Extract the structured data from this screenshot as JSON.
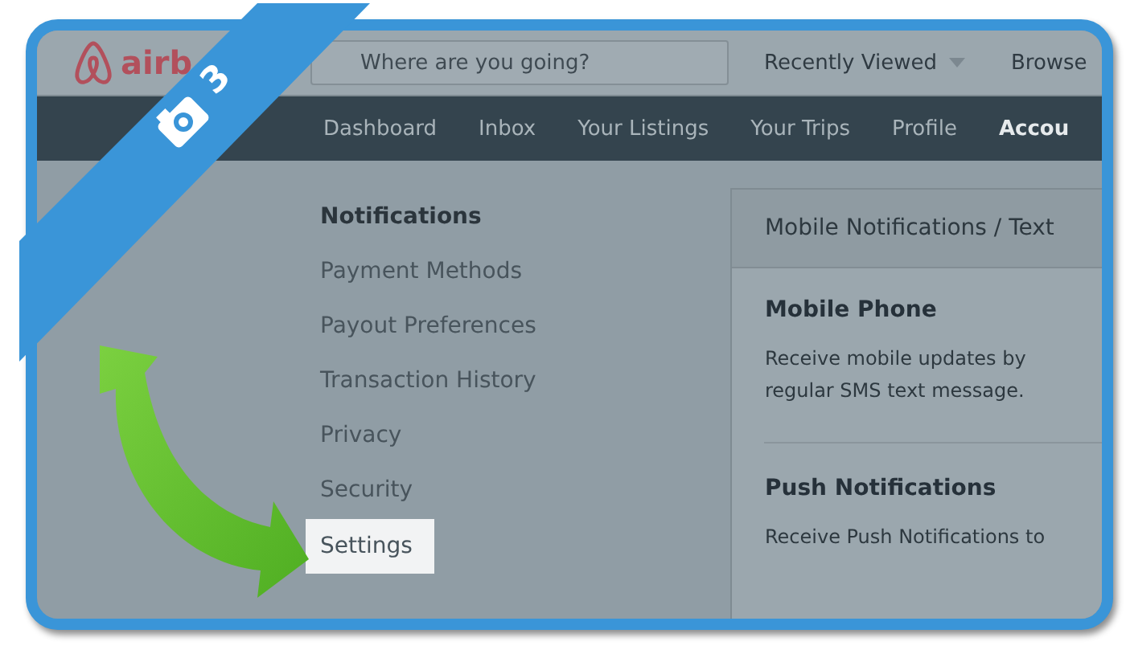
{
  "header": {
    "logo_text": "airb",
    "search": {
      "placeholder": "Where are you going?"
    },
    "menus": [
      {
        "label": "Recently Viewed",
        "dropdown": true
      },
      {
        "label": "Browse",
        "dropdown": false
      }
    ]
  },
  "nav": {
    "tabs": [
      {
        "label": "Dashboard",
        "selected": false
      },
      {
        "label": "Inbox",
        "selected": false
      },
      {
        "label": "Your Listings",
        "selected": false
      },
      {
        "label": "Your Trips",
        "selected": false
      },
      {
        "label": "Profile",
        "selected": false
      },
      {
        "label": "Accou",
        "selected": true
      }
    ]
  },
  "sidebar": {
    "items": [
      {
        "label": "Notifications",
        "selected": true,
        "highlighted": false
      },
      {
        "label": "Payment Methods",
        "selected": false,
        "highlighted": false
      },
      {
        "label": "Payout Preferences",
        "selected": false,
        "highlighted": false
      },
      {
        "label": "Transaction History",
        "selected": false,
        "highlighted": false
      },
      {
        "label": "Privacy",
        "selected": false,
        "highlighted": false
      },
      {
        "label": "Security",
        "selected": false,
        "highlighted": false
      },
      {
        "label": "Settings",
        "selected": false,
        "highlighted": true
      }
    ]
  },
  "panel": {
    "title": "Mobile Notifications / Text",
    "sections": [
      {
        "heading": "Mobile Phone",
        "text": "Receive mobile updates by regular SMS text message."
      },
      {
        "heading": "Push Notifications",
        "text": "Receive Push Notifications to"
      }
    ]
  },
  "step_badge": {
    "number": "3"
  }
}
